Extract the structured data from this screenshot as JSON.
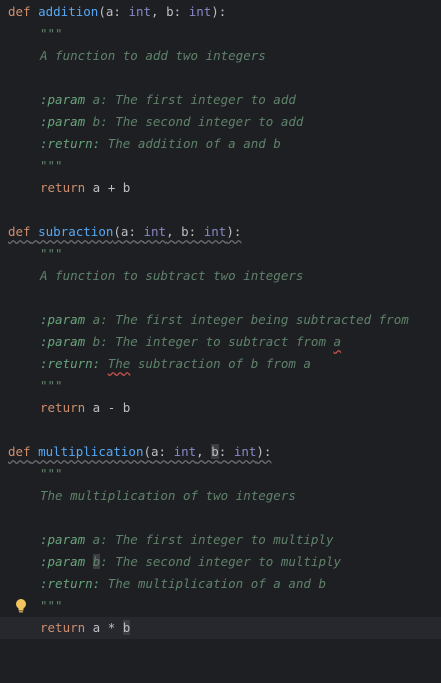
{
  "tokens": {
    "def": "def",
    "return": "return",
    "int": "int",
    "a": "a",
    "b": "b",
    "colon": ":",
    "comma": ",",
    "open": "(",
    "close": "):",
    "triple": "\"\"\"",
    "param": ":param",
    "ret": ":return:"
  },
  "functions": [
    {
      "name": "addition",
      "summary": "A function to add two integers",
      "param_a": " a: The first integer to add",
      "param_b": " b: The second integer to add",
      "returns": " The addition of a and b",
      "return_expr": " a + b"
    },
    {
      "name": "subraction",
      "summary": "A function to subtract two integers",
      "param_a": " a: The first integer being subtracted from",
      "param_b_pre": " b: The integer to subtract from ",
      "param_b_err": "a",
      "returns_err": "The",
      "returns_rest": " subtraction of b from a",
      "return_expr": " a - b"
    },
    {
      "name": "multiplication",
      "summary": "The multiplication of two integers",
      "param_a": " a: The first integer to multiply",
      "param_b_hl": "b",
      "param_b_rest": ": The second integer to multiply",
      "returns": " The multiplication of a and b",
      "return_expr": " a * ",
      "return_b": "b"
    }
  ],
  "gutter": {
    "icon": "lightbulb-icon"
  },
  "colors": {
    "background": "#1e1f22",
    "keyword": "#cf8e6d",
    "function": "#56a8f5",
    "type": "#8888c6",
    "docstring": "#5f826b",
    "text": "#bcbec4"
  }
}
